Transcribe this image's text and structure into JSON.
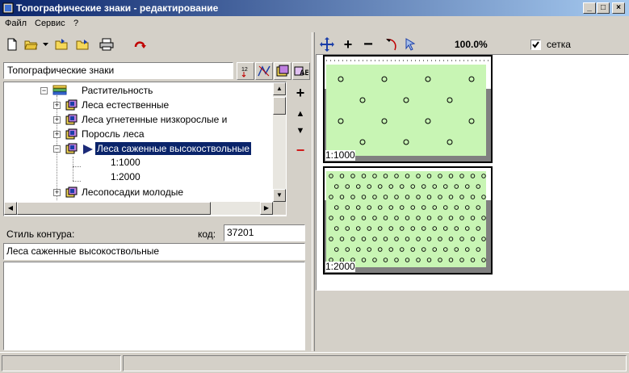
{
  "window": {
    "title": "Топографические знаки - редактирование",
    "caption_buttons": [
      "_",
      "□",
      "×"
    ]
  },
  "menu": [
    "Файл",
    "Сервис",
    "?"
  ],
  "left_panel": {
    "search_value": "Топографические знаки",
    "tree": {
      "parent_label": "Растительность",
      "items": [
        {
          "label": "Леса естественные",
          "expander": "+"
        },
        {
          "label": "Леса угнетенные низкорослые и",
          "expander": "+"
        },
        {
          "label": "Поросль леса",
          "expander": "+"
        },
        {
          "label": "Леса саженные высокоствольные",
          "expander": "−",
          "selected": true
        },
        {
          "label": "1:1000",
          "child": true
        },
        {
          "label": "1:2000",
          "child": true
        },
        {
          "label": "Лесопосадки молодые",
          "expander": "+"
        }
      ]
    },
    "side_buttons": [
      "+",
      "▲",
      "▼",
      "−"
    ],
    "contour_style_label": "Стиль контура:",
    "code_label": "код:",
    "code_value": "37201",
    "name_value": "Леса саженные высокоствольные"
  },
  "right_panel": {
    "zoom_value": "100.0%",
    "grid_label": "сетка",
    "grid_checked": true,
    "previews": [
      {
        "scale_label": "1:1000"
      },
      {
        "scale_label": "1:2000"
      }
    ]
  },
  "colors": {
    "title_start": "#0a246a",
    "title_end": "#a6caf0",
    "selection": "#0a246a",
    "fill_green": "#c8f5b4",
    "shadow_gray": "#808080"
  }
}
